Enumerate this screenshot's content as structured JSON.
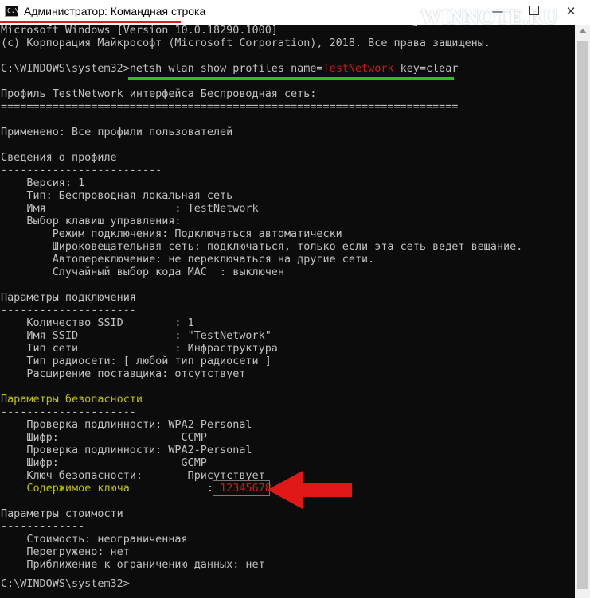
{
  "window": {
    "title": "Администратор: Командная строка",
    "icon_text": "C:\\_",
    "minimize": "—",
    "close": "✕"
  },
  "watermark": {
    "text": "WINNOTE.RU"
  },
  "colors": {
    "console_bg": "#0c0c0c",
    "text": "#c0c0c0",
    "highlight_yellow": "#c0c000",
    "highlight_red": "#d41818",
    "underline_green": "#1ec81e",
    "underline_red": "#e21c1c"
  },
  "console": {
    "lines": [
      "Microsoft Windows [Version 10.0.18290.1000]",
      "(с) Корпорация Майкрософт (Microsoft Corporation), 2018. Все права защищены.",
      "",
      "",
      "",
      "Профиль TestNetwork интерфейса Беспроводная сеть:",
      "=======================================================================",
      "",
      "Применено: Все профили пользователей",
      "",
      "Сведения о профиле",
      "-------------------------",
      "    Версия: 1",
      "    Тип: Беспроводная локальная сеть",
      "    Имя                    : TestNetwork",
      "    Выбор клавиш управления:",
      "        Режим подключения: Подключаться автоматически",
      "        Широковещательная сеть: подключаться, только если эта сеть ведет вещание.",
      "        Автопереключение: не переключаться на другие сети.",
      "        Случайный выбор кода МАС  : выключен",
      "",
      "Параметры подключения",
      "---------------------",
      "    Количество SSID        : 1",
      "    Имя SSID               : \"TestNetwork\"",
      "    Тип сети               : Инфраструктура",
      "    Тип радиосети: [ любой тип радиосети ]",
      "    Расширение поставщика: отсутствует",
      "",
      "",
      "---------------------",
      "    Проверка подлинности: WPA2-Personal",
      "    Шифр:                   CCMP",
      "    Проверка подлинности: WPA2-Personal",
      "    Шифр:                   GCMP",
      "    Ключ безопасности:       Присутствует",
      "",
      "",
      "Параметры стоимости",
      "-------------",
      "    Стоимость: неограниченная",
      "    Перегружено: нет",
      "    Приближение к ограничению данных: нет",
      "C:\\WINDOWS\\system32>"
    ],
    "command": {
      "prompt": "C:\\WINDOWS\\system32>",
      "part1": "netsh wlan show profiles name=",
      "network_name": "TestNetwork",
      "part2": " key=clear"
    },
    "security_header": "Параметры безопасности",
    "key_content": {
      "label": "    Содержимое ключа",
      "separator": "            : ",
      "value": "12345678"
    }
  }
}
